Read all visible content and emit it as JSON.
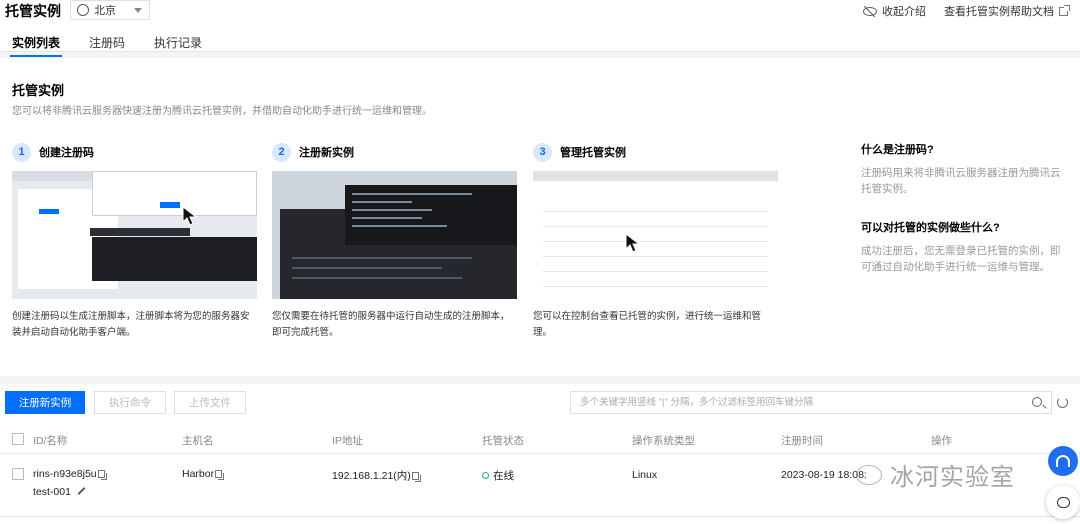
{
  "header": {
    "title": "托管实例",
    "region": "北京",
    "links": [
      {
        "label": "收起介绍",
        "icon": "eye-off-icon"
      },
      {
        "label": "查看托管实例帮助文档",
        "icon": "external-link-icon"
      }
    ]
  },
  "tabs": [
    {
      "label": "实例列表",
      "active": true
    },
    {
      "label": "注册码",
      "active": false
    },
    {
      "label": "执行记录",
      "active": false
    }
  ],
  "intro": {
    "title": "托管实例",
    "description": "您可以将非腾讯云服务器快速注册为腾讯云托管实例，并借助自动化助手进行统一运维和管理。",
    "steps": [
      {
        "num": "1",
        "label": "创建注册码",
        "text": "创建注册码以生成注册脚本，注册脚本将为您的服务器安装并启动自动化助手客户端。"
      },
      {
        "num": "2",
        "label": "注册新实例",
        "text": "您仅需要在待托管的服务器中运行自动生成的注册脚本，即可完成托管。"
      },
      {
        "num": "3",
        "label": "管理托管实例",
        "text": "您可以在控制台查看已托管的实例，进行统一运维和管理。"
      }
    ],
    "faq": [
      {
        "q": "什么是注册码?",
        "a": "注册码用来将非腾讯云服务器注册为腾讯云托管实例。"
      },
      {
        "q": "可以对托管的实例做些什么?",
        "a": "成功注册后，您无需登录已托管的实例，即可通过自动化助手进行统一运维与管理。"
      }
    ]
  },
  "toolbar": {
    "register_label": "注册新实例",
    "execute_label": "执行命令",
    "upload_label": "上传文件",
    "search_placeholder": "多个关键字用竖线 \"|\" 分隔，多个过滤标签用回车键分隔"
  },
  "table": {
    "columns": [
      "ID/名称",
      "主机名",
      "IP地址",
      "托管状态",
      "操作系统类型",
      "注册时间",
      "操作"
    ],
    "rows": [
      {
        "id": "rins-n93e8j5u",
        "name": "test-001",
        "hostname": "Harbor",
        "ip": "192.168.1.21(内)",
        "status": "在线",
        "os": "Linux",
        "registered": "2023-08-19 18:08:"
      }
    ]
  },
  "watermark": "冰河实验室",
  "colors": {
    "primary": "#006eff",
    "online": "#0abf5b"
  }
}
